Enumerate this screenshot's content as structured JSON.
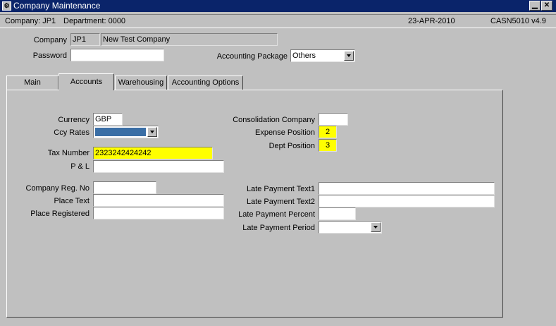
{
  "window": {
    "title": "Company Maintenance",
    "icon": "app-icon",
    "minimize": "▁",
    "close": "✕"
  },
  "info": {
    "company": "Company:  JP1",
    "department": "Department:  0000",
    "date": "23-APR-2010",
    "program": "CASN5010  v4.9"
  },
  "header": {
    "company_label": "Company",
    "company_code": "JP1",
    "company_name": "New Test Company",
    "password_label": "Password",
    "password_value": "",
    "acct_pkg_label": "Accounting Package",
    "acct_pkg_value": "Others"
  },
  "tabs": [
    "Main",
    "Accounts",
    "Warehousing",
    "Accounting Options"
  ],
  "active_tab": "Accounts",
  "accounts": {
    "currency_label": "Currency",
    "currency_value": "GBP",
    "ccy_rates_label": "Ccy Rates",
    "ccy_rates_value": "",
    "tax_number_label": "Tax Number",
    "tax_number_value": "2323242424242",
    "pl_label": "P & L",
    "pl_value": "",
    "company_reg_label": "Company Reg. No",
    "company_reg_value": "",
    "place_text_label": "Place Text",
    "place_text_value": "",
    "place_registered_label": "Place Registered",
    "place_registered_value": "",
    "consolidation_label": "Consolidation Company",
    "consolidation_value": "",
    "expense_position_label": "Expense Position",
    "expense_position_value": "2",
    "dept_position_label": "Dept Position",
    "dept_position_value": "3",
    "late_text1_label": "Late Payment Text1",
    "late_text1_value": "",
    "late_text2_label": "Late Payment Text2",
    "late_text2_value": "",
    "late_percent_label": "Late Payment Percent",
    "late_percent_value": "",
    "late_period_label": "Late Payment Period",
    "late_period_value": ""
  },
  "colors": {
    "titlebar": "#0a246a",
    "highlight": "#ffff00",
    "selection": "#3a6ea5"
  }
}
